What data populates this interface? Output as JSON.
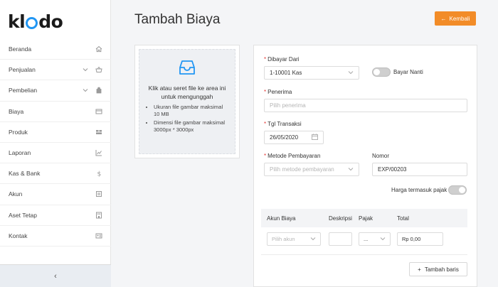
{
  "app": {
    "logo_prefix": "kl",
    "logo_suffix": "do"
  },
  "sidebar": {
    "items": [
      {
        "label": "Beranda",
        "icon": "home-icon",
        "chevron": false
      },
      {
        "label": "Penjualan",
        "icon": "basket-icon",
        "chevron": true
      },
      {
        "label": "Pembelian",
        "icon": "bag-icon",
        "chevron": true
      },
      {
        "label": "Biaya",
        "icon": "card-icon",
        "chevron": false
      },
      {
        "label": "Produk",
        "icon": "box-icon",
        "chevron": false
      },
      {
        "label": "Laporan",
        "icon": "chart-icon",
        "chevron": false
      },
      {
        "label": "Kas & Bank",
        "icon": "dollar-icon",
        "chevron": false
      },
      {
        "label": "Akun",
        "icon": "list-icon",
        "chevron": false
      },
      {
        "label": "Aset Tetap",
        "icon": "building-icon",
        "chevron": false
      },
      {
        "label": "Kontak",
        "icon": "contact-icon",
        "chevron": false
      }
    ],
    "collapse_glyph": "‹"
  },
  "page": {
    "title": "Tambah Biaya",
    "back_label": "Kembali",
    "back_glyph": "←"
  },
  "upload": {
    "title": "Klik atau seret file ke area ini untuk mengunggah",
    "notes": [
      "Ukuran file gambar maksimal 10 MB",
      "Dimensi file gambar maksimal 3000px * 3000px"
    ]
  },
  "form": {
    "paid_from": {
      "label": "Dibayar Dari",
      "value": "1-10001 Kas"
    },
    "pay_later": {
      "label": "Bayar Nanti",
      "on": false
    },
    "recipient": {
      "label": "Penerima",
      "placeholder": "Pilih penerima"
    },
    "date": {
      "label": "Tgl Transaksi",
      "value": "26/05/2020"
    },
    "payment_method": {
      "label": "Metode Pembayaran",
      "placeholder": "Pilih metode pembayaran"
    },
    "number": {
      "label": "Nomor",
      "value": "EXP/00203"
    },
    "tax_inclusive": {
      "label": "Harga termasuk pajak",
      "on": false
    },
    "required_mark": "*"
  },
  "table": {
    "headers": {
      "account": "Akun Biaya",
      "description": "Deskripsi",
      "tax": "Pajak",
      "total": "Total"
    },
    "row": {
      "account_placeholder": "Pilih akun",
      "tax_value": "...",
      "total_value": "Rp 0,00"
    },
    "add_row_label": "Tambah baris",
    "add_row_glyph": "+"
  },
  "colors": {
    "accent": "#f28c28",
    "brand_blue": "#2196f3",
    "required": "#e53935"
  }
}
